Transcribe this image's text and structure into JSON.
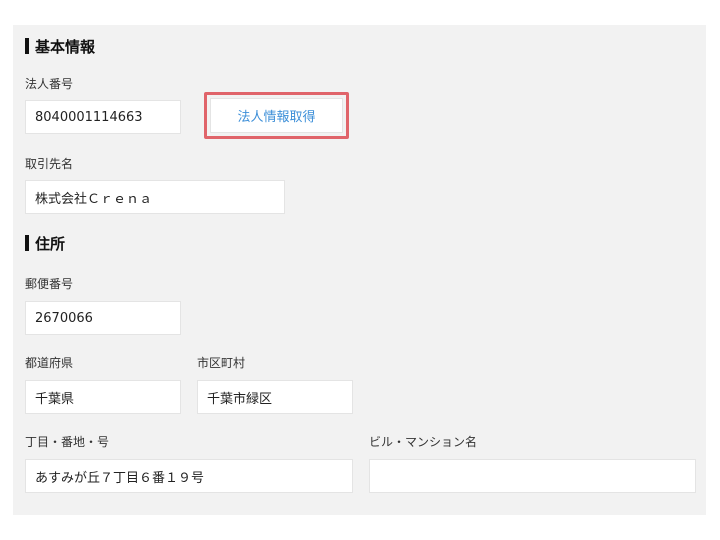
{
  "basic_info": {
    "heading": "基本情報",
    "corporate_number_label": "法人番号",
    "corporate_number_value": "8040001114663",
    "fetch_button_label": "法人情報取得",
    "client_name_label": "取引先名",
    "client_name_value": "株式会社Ｃｒｅｎａ"
  },
  "address": {
    "heading": "住所",
    "postal_code_label": "郵便番号",
    "postal_code_value": "2670066",
    "prefecture_label": "都道府県",
    "prefecture_value": "千葉県",
    "city_label": "市区町村",
    "city_value": "千葉市緑区",
    "street_label": "丁目・番地・号",
    "street_value": "あすみが丘７丁目６番１９号",
    "building_label": "ビル・マンション名",
    "building_value": ""
  },
  "colors": {
    "panel_bg": "#f2f2f2",
    "highlight_border": "#e0646a",
    "link_blue": "#3d8fd8"
  }
}
